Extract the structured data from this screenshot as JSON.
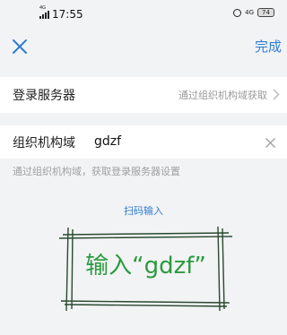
{
  "status_bar": {
    "network_label": "4G",
    "time": "17:55",
    "net_right": "4G",
    "battery": "74"
  },
  "nav": {
    "done_label": "完成"
  },
  "server_row": {
    "label": "登录服务器",
    "value": "通过组织机构域获取"
  },
  "org_row": {
    "label": "组织机构域",
    "input_value": "gdzf"
  },
  "hint": "通过组织机构域，获取登录服务器设置",
  "scan_link": "扫码输入",
  "stamp": {
    "text": "输入“gdzf”"
  },
  "colors": {
    "accent": "#2f7dd0",
    "stamp_green": "#2b9a3e",
    "background": "#f2f3f5"
  }
}
